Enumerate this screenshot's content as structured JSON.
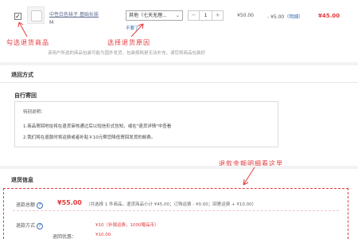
{
  "product": {
    "checkbox_mark": "✓",
    "name": "中性白色袜子 基础长袜",
    "spec": "M",
    "reason_selected": "其他（七天无理...",
    "quantity": "1",
    "minus": "−",
    "plus": "+",
    "unit_price": "¥50.00",
    "discount": "- ¥5.00",
    "discount_link": "（明细）",
    "subtotal": "¥45.00",
    "not_want_link": "不要了"
  },
  "annotations": {
    "select_goods": "勾选退货商品",
    "select_reason": "选择退货原因",
    "refund_detail": "退款金额明细看这里"
  },
  "notice": "该用户所选的商品包装可能为国外发货，包装损耗是无法补充，请您将商品包装好",
  "return_method": {
    "title": "退回方式",
    "self_send_title": "自行寄回",
    "box_title": "特别说明：",
    "line1": "1.商品寄回地址将在退货审核通过后以短信形式告知，或在\"退货详情\"中查看",
    "line2": "2.我们将在退款时将运费或者补贴￥10元帮您降低寄回发货的邮费。"
  },
  "refund_info": {
    "title": "退货信息",
    "total_label": "退款总额",
    "help_icon": "?",
    "total_amount": "¥55.00",
    "breakdown": "（共选择 1 件商品，退货商品小计 ¥45.00；订购运费 - ¥0.00；回寄运费 + ¥10.00）",
    "method_label": "退款方式",
    "method_value": "¥10（补偿运费，1000赠品币）",
    "coupon_label": "退回优惠：",
    "coupon_value": "¥10.00"
  },
  "colors": {
    "accent_red": "#e4393c",
    "link_blue": "#3b6fb5"
  }
}
